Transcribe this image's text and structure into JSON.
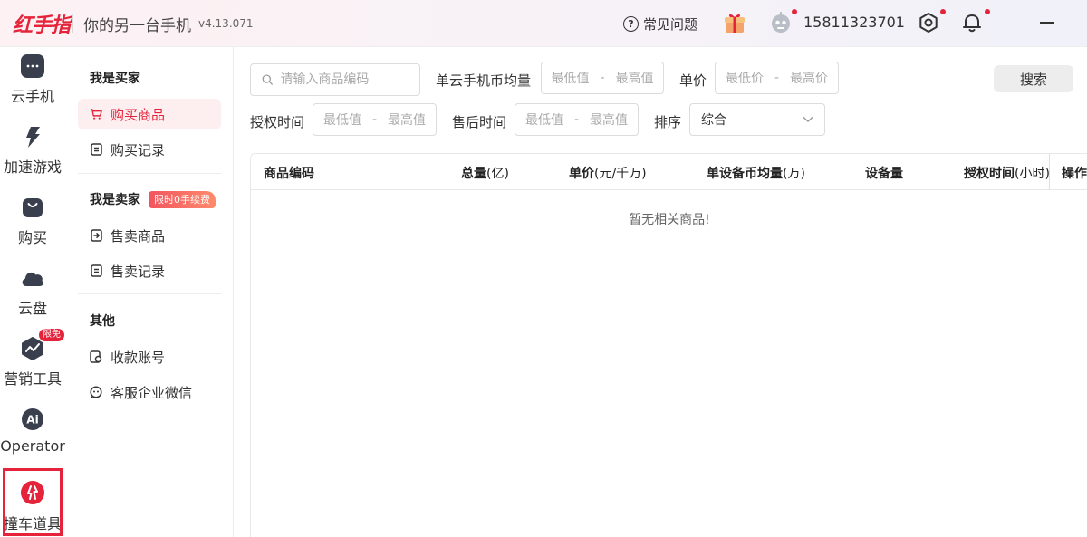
{
  "titlebar": {
    "brand": "红手指",
    "subtitle": "你的另一台手机",
    "version": "v4.13.071",
    "faq_label": "常见问题",
    "phone": "15811323701"
  },
  "rail": {
    "items": [
      {
        "label": "云手机",
        "icon": "cloud-phone-icon"
      },
      {
        "label": "加速游戏",
        "icon": "lightning-icon"
      },
      {
        "label": "购买",
        "icon": "shopping-bag-icon"
      },
      {
        "label": "云盘",
        "icon": "cloud-icon"
      },
      {
        "label": "营销工具",
        "icon": "trend-chart-icon"
      },
      {
        "label": "Operator",
        "icon": "ai-icon"
      },
      {
        "label": "撞车道具",
        "icon": "collision-props-icon"
      }
    ],
    "free_badge": "限免"
  },
  "sidenav": {
    "buyer_heading": "我是买家",
    "buyer_items": [
      {
        "label": "购买商品",
        "icon": "cart-icon",
        "active": true
      },
      {
        "label": "购买记录",
        "icon": "record-icon"
      }
    ],
    "seller_heading": "我是卖家",
    "seller_promo": "限时0手续费",
    "seller_items": [
      {
        "label": "售卖商品",
        "icon": "sell-icon"
      },
      {
        "label": "售卖记录",
        "icon": "record-icon"
      }
    ],
    "other_heading": "其他",
    "other_items": [
      {
        "label": "收款账号",
        "icon": "account-icon"
      },
      {
        "label": "客服企业微信",
        "icon": "wechat-icon"
      }
    ]
  },
  "filters": {
    "search_placeholder": "请输入商品编码",
    "coin_avg_label": "单云手机币均量",
    "min_value": "最低值",
    "max_value": "最高值",
    "range_sep": "-",
    "unit_price_label": "单价",
    "min_price": "最低价",
    "max_price": "最高价",
    "auth_time_label": "授权时间",
    "after_sale_label": "售后时间",
    "sort_label": "排序",
    "sort_value": "综合",
    "search_button": "搜索"
  },
  "table": {
    "columns": [
      {
        "label": "商品编码",
        "unit": ""
      },
      {
        "label": "总量",
        "unit": "(亿)"
      },
      {
        "label": "单价",
        "unit": "(元/千万)"
      },
      {
        "label": "单设备币均量",
        "unit": "(万)"
      },
      {
        "label": "设备量",
        "unit": ""
      },
      {
        "label": "授权时间",
        "unit": "(小时)"
      },
      {
        "label": "操作",
        "unit": ""
      }
    ],
    "empty_text": "暂无相关商品!"
  },
  "colors": {
    "brand": "#e5243b",
    "active_bg": "#fdeef0",
    "rail_icon": "#3a3f4d"
  }
}
